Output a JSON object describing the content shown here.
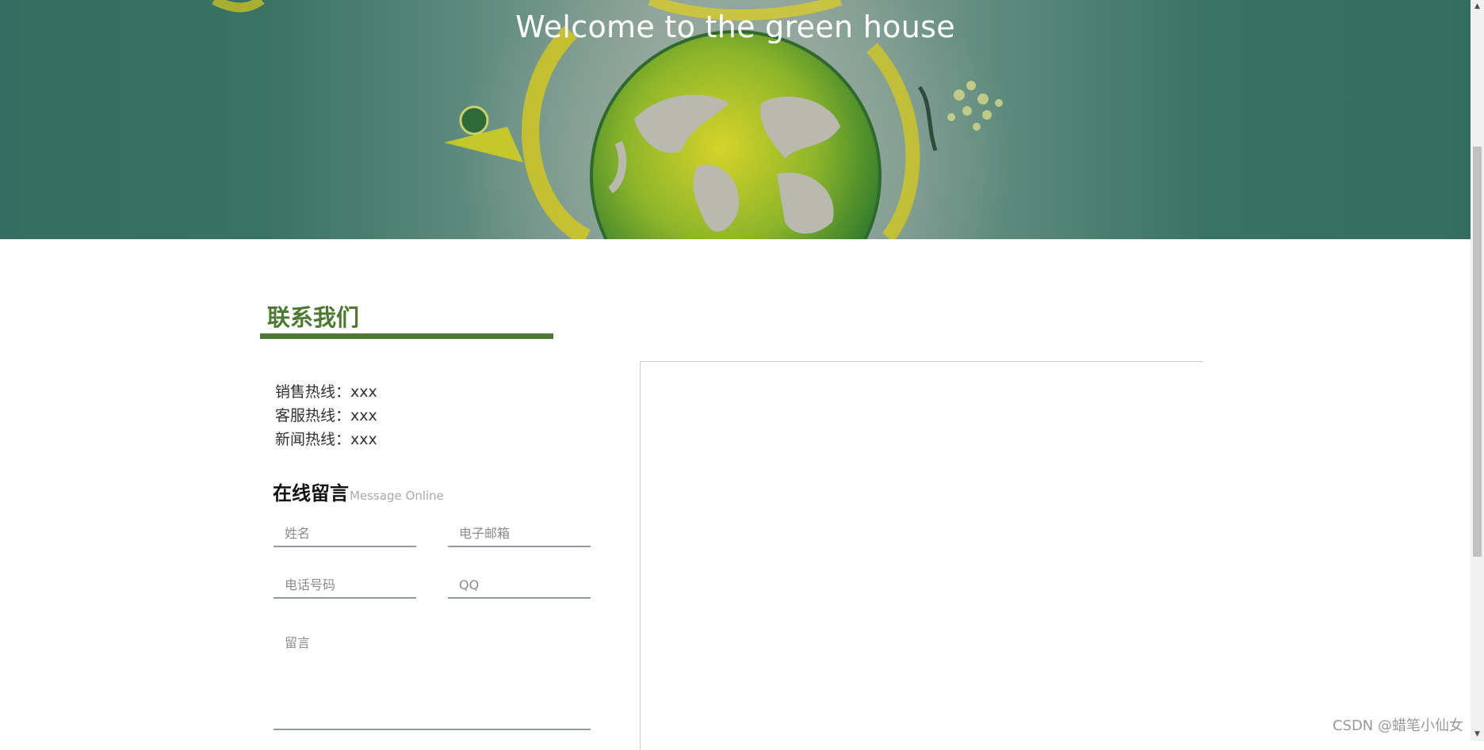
{
  "banner": {
    "title": "Welcome to the green house"
  },
  "contact": {
    "section_title": "联系我们",
    "hotlines": [
      {
        "label": "销售热线：",
        "value": "xxx"
      },
      {
        "label": "客服热线：",
        "value": "xxx"
      },
      {
        "label": "新闻热线：",
        "value": "xxx"
      }
    ]
  },
  "message": {
    "title_cn": "在线留言",
    "title_en": "Message Online",
    "fields": {
      "name_placeholder": "姓名",
      "email_placeholder": "电子邮箱",
      "phone_placeholder": "电话号码",
      "qq_placeholder": "QQ",
      "message_placeholder": "留言"
    }
  },
  "watermark": "CSDN @蜡笔小仙女",
  "colors": {
    "banner_bg": "#356e60",
    "accent_green": "#4d7a33",
    "field_underline": "#8e9ea1"
  },
  "icons": [
    "earth-globe-icon",
    "scroll-up-arrow-icon",
    "scroll-down-arrow-icon"
  ]
}
